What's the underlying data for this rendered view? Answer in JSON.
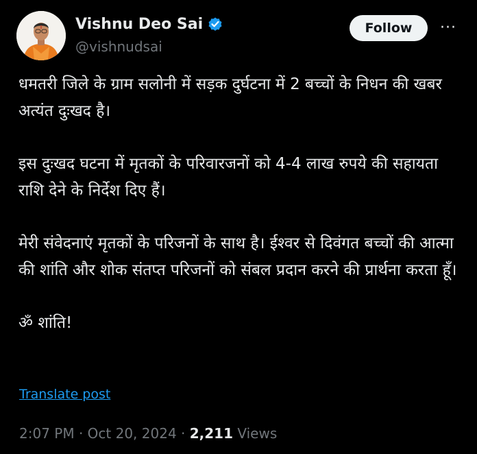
{
  "author": {
    "display_name": "Vishnu Deo Sai",
    "handle": "@vishnudsai",
    "verified_icon": "verified-badge-icon",
    "verified_color": "#1d9bf0"
  },
  "actions": {
    "follow_label": "Follow",
    "more_label": "···"
  },
  "tweet": {
    "paragraphs": [
      "धमतरी जिले के ग्राम सलोनी में सड़क दुर्घटना में 2 बच्चों के निधन की खबर अत्यंत दुःखद है।",
      "इस दुःखद घटना में मृतकों के परिवारजनों को 4-4 लाख रुपये की सहायता राशि देने के निर्देश दिए हैं।",
      "मेरी संवेदनाएं मृतकों के परिजनों के साथ है। ईश्वर से दिवंगत बच्चों की आत्मा की शांति और शोक संतप्त परिजनों को संबल प्रदान करने की प्रार्थना करता हूँ।",
      "ॐ शांति!"
    ],
    "translate_label": "Translate post"
  },
  "meta": {
    "time": "2:07 PM",
    "separator": " · ",
    "date": "Oct 20, 2024",
    "views_count": "2,211",
    "views_label": " Views"
  },
  "colors": {
    "background": "#000000",
    "text_primary": "#e7e9ea",
    "text_secondary": "#71767b",
    "accent": "#1d9bf0",
    "follow_bg": "#eff3f4"
  }
}
